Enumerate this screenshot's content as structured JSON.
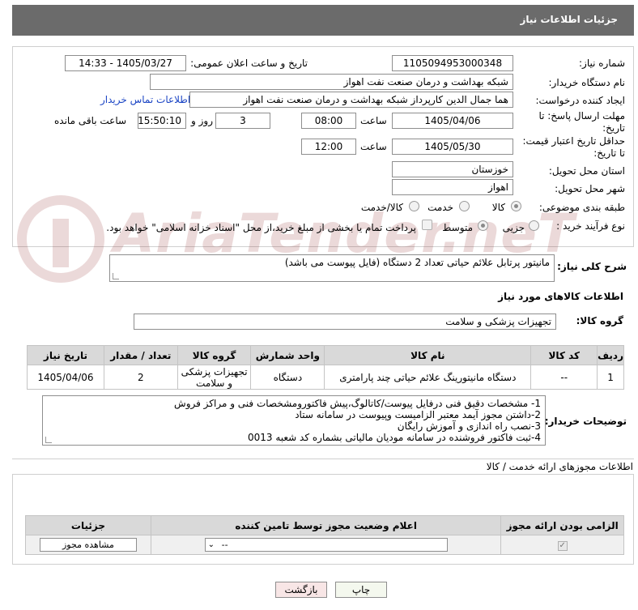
{
  "header": {
    "title": "جزئیات اطلاعات نیاز"
  },
  "form": {
    "need_number_label": "شماره نیاز:",
    "need_number": "1105094953000348",
    "announce_label": "تاریخ و ساعت اعلان عمومی:",
    "announce_value": "1405/03/27 - 14:33",
    "buyer_label": "نام دستگاه خریدار:",
    "buyer_value": "شبکه بهداشت و درمان صنعت نفت اهواز",
    "creator_label": "ایجاد کننده درخواست:",
    "creator_value": "هما جمال الدین کارپرداز شبکه بهداشت و درمان صنعت نفت اهواز",
    "contact_link": "اطلاعات تماس خریدار",
    "deadline_label_1": "مهلت ارسال پاسخ: تا",
    "deadline_label_2": "تاریخ:",
    "deadline_date": "1405/04/06",
    "time_label": "ساعت",
    "deadline_time": "08:00",
    "days_value": "3",
    "days_label": "روز و",
    "remaining_time": "15:50:10",
    "remaining_label": "ساعت باقی مانده",
    "validity_label_1": "حداقل تاریخ اعتبار قیمت:",
    "validity_label_2": "تا تاریخ:",
    "validity_date": "1405/05/30",
    "validity_time": "12:00",
    "province_label": "استان محل تحویل:",
    "province_value": "خوزستان",
    "city_label": "شهر محل تحویل:",
    "city_value": "اهواز",
    "category_label": "طبقه بندی موضوعی:",
    "category_options": [
      "کالا",
      "خدمت",
      "کالا/خدمت"
    ],
    "process_label": "نوع فرآیند خرید :",
    "process_options": [
      "جزیی",
      "متوسط"
    ],
    "payment_note": "پرداخت تمام یا بخشی از مبلغ خرید،از محل \"اسناد خزانه اسلامی\" خواهد بود."
  },
  "description": {
    "label": "شرح کلی نیاز:",
    "value": "مانیتور پرتابل علائم حیاتی تعداد 2 دستگاه (فایل پیوست می باشد)"
  },
  "goods": {
    "section_title": "اطلاعات کالاهای مورد نیاز",
    "group_label": "گروه کالا:",
    "group_value": "تجهیزات پزشکی و سلامت",
    "columns": [
      "ردیف",
      "کد کالا",
      "نام کالا",
      "واحد شمارش",
      "گروه کالا",
      "تعداد / مقدار",
      "تاریخ نیاز"
    ],
    "rows": [
      [
        "1",
        "--",
        "دستگاه مانیتورینگ علائم حیاتی چند پارامتری",
        "دستگاه",
        "تجهیزات پزشکی و سلامت",
        "2",
        "1405/04/06"
      ]
    ]
  },
  "buyer_notes": {
    "label": "توضیحات خریدار:",
    "lines": [
      "1- مشخصات دقیق فنی درفایل پیوست/کاتالوگ،پیش فاکتورومشخصات فنی و مراکز فروش",
      "2-داشتن مجوز آیمد معتبر الزامیست وپیوست در سامانه ستاد",
      "3-نصب راه اندازی و آموزش رایگان",
      "4-ثبت فاکتور فروشنده در سامانه مودیان مالیاتی بشماره کد شعبه 0013"
    ]
  },
  "permits": {
    "section_title": "اطلاعات مجوزهای ارائه خدمت / کالا",
    "columns": [
      "الزامی بودن ارائه مجوز",
      "اعلام وضعیت مجوز توسط تامین کننده",
      "جزئیات"
    ],
    "select_value": "--",
    "view_button": "مشاهده مجوز"
  },
  "actions": {
    "print": "چاپ",
    "back": "بازگشت"
  },
  "watermark": "AriaTender.neT"
}
